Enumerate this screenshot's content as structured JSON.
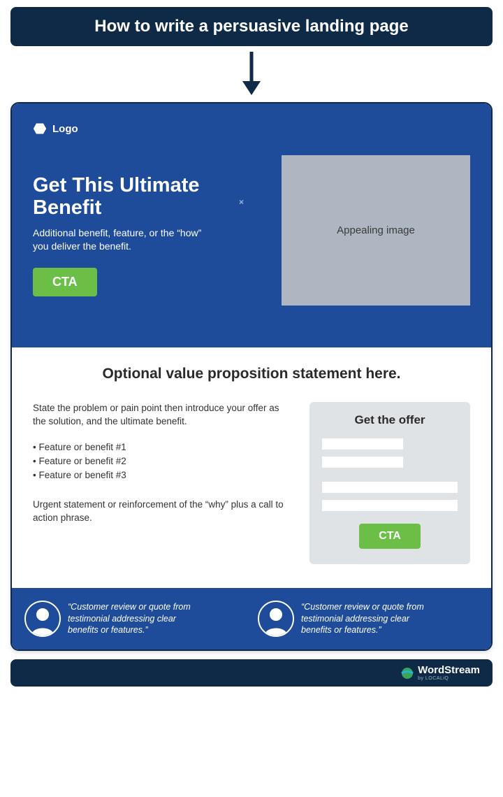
{
  "title": "How to write a persuasive landing page",
  "hero": {
    "logo_label": "Logo",
    "headline": "Get This Ultimate Benefit",
    "subhead": "Additional benefit, feature, or the “how” you deliver the benefit.",
    "cta_label": "CTA",
    "image_label": "Appealing image",
    "close_char": "×"
  },
  "mid": {
    "value_prop": "Optional value proposition statement here.",
    "problem": "State the problem or pain point then introduce your offer as the solution, and the ultimate benefit.",
    "features": [
      "• Feature or benefit #1",
      "• Feature or benefit #2",
      "• Feature or benefit #3"
    ],
    "urgent": "Urgent statement or reinforcement of the “why” plus a call to action phrase."
  },
  "form": {
    "title": "Get the offer",
    "cta_label": "CTA"
  },
  "testimonials": [
    {
      "quote": "“Customer review or quote from testimonial addressing clear benefits or features.”"
    },
    {
      "quote": "“Customer review or quote from testimonial addressing clear benefits or features.”"
    }
  ],
  "footer": {
    "brand": "WordStream",
    "byline": "by LOCALiQ"
  }
}
